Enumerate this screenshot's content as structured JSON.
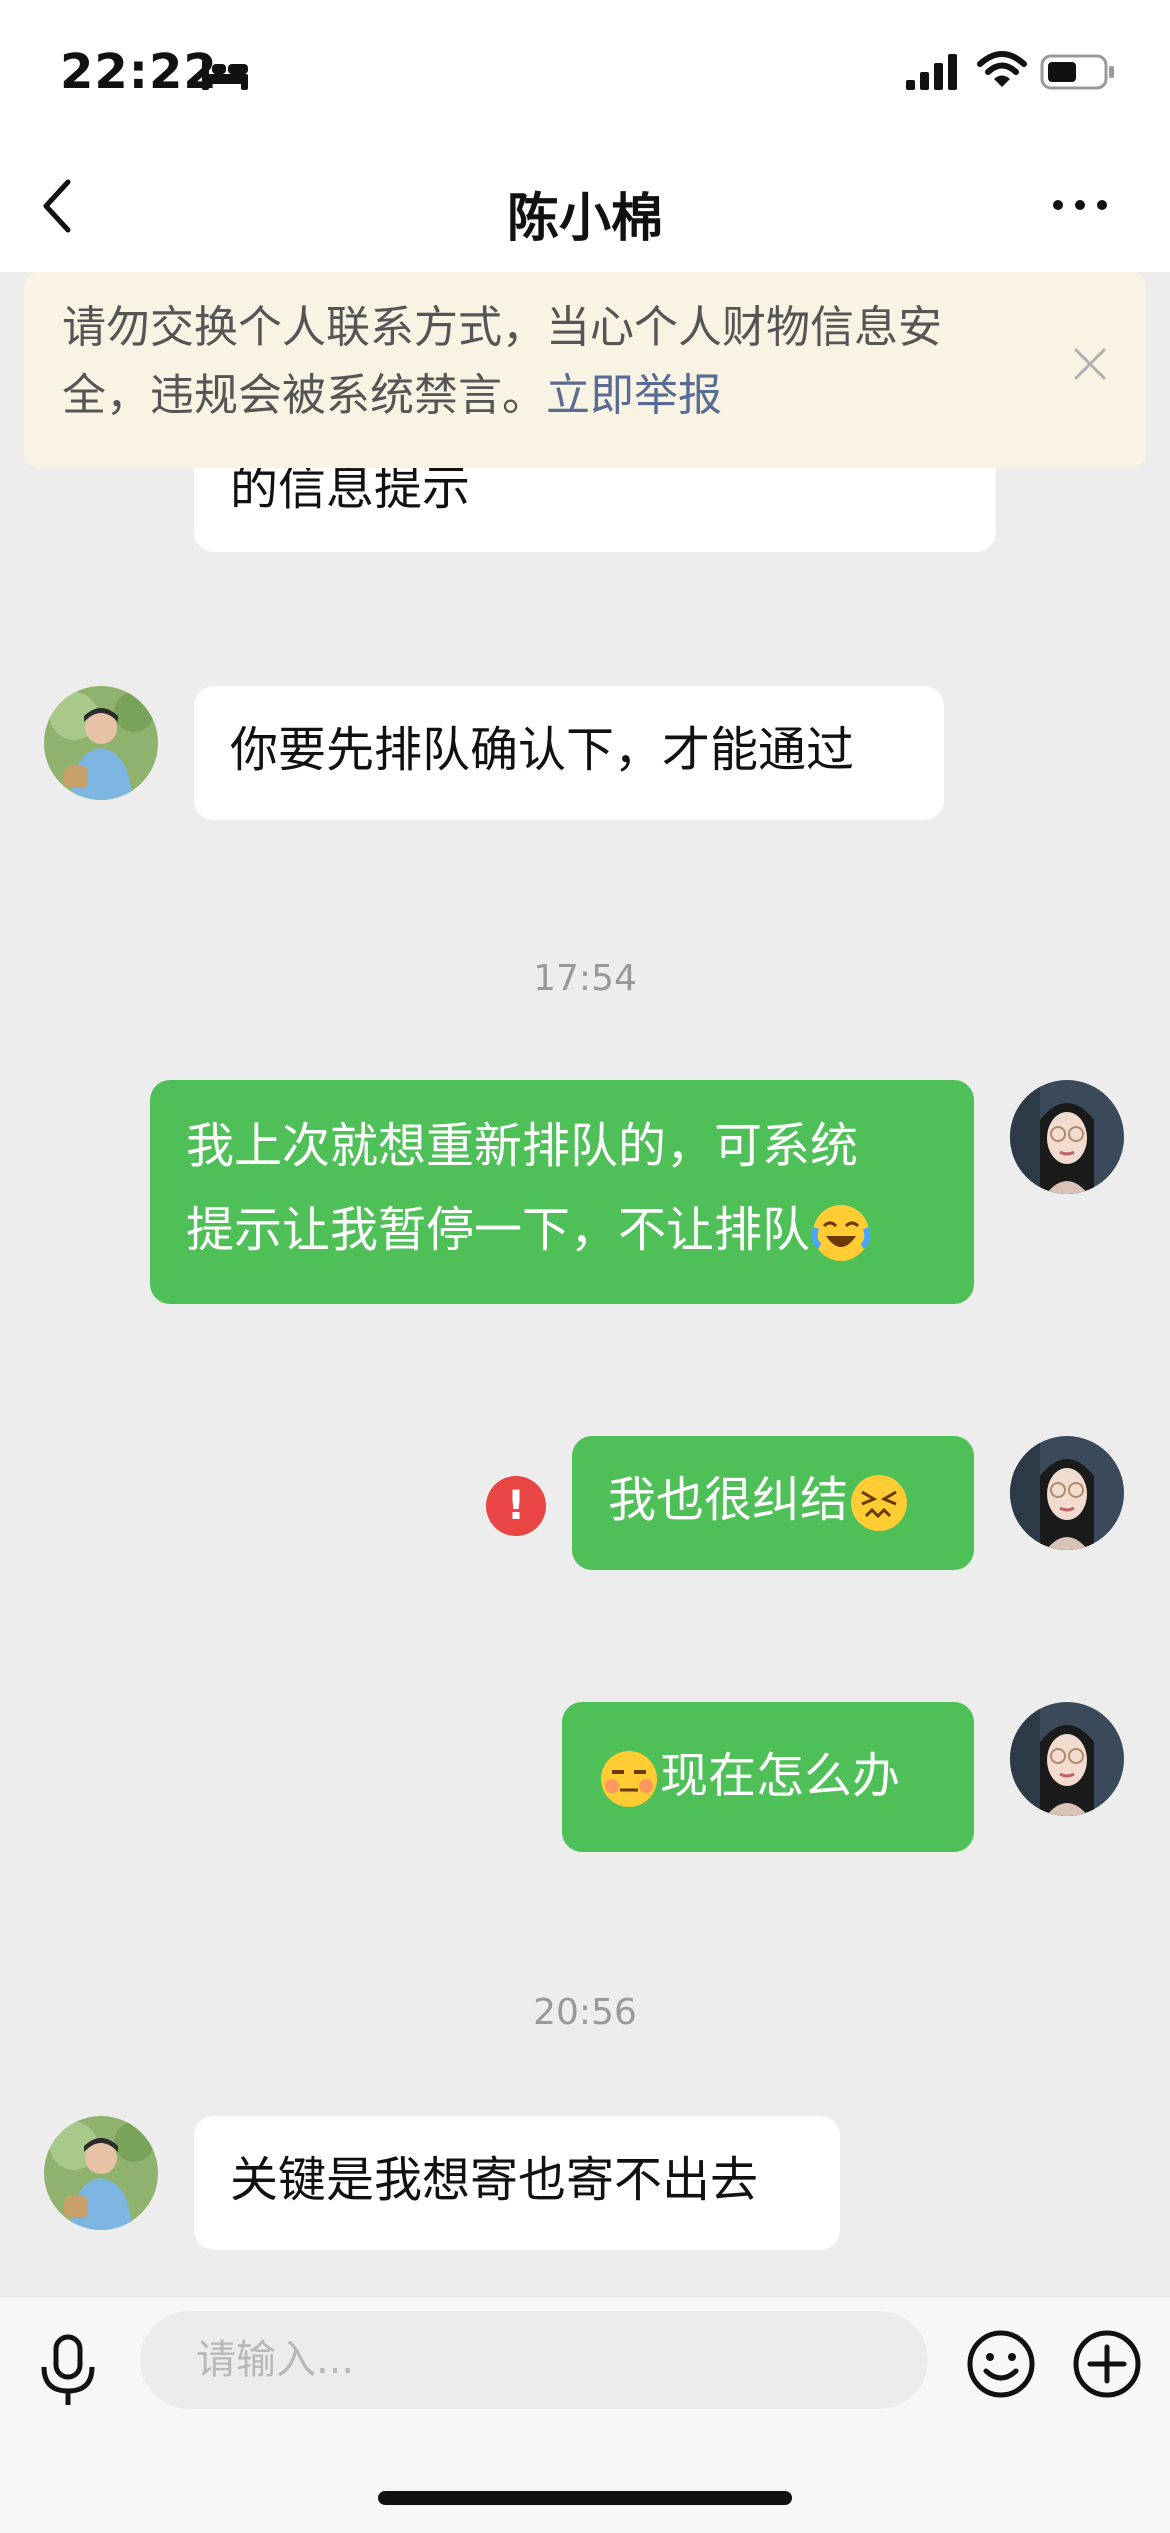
{
  "status_bar": {
    "time": "22:22",
    "icons": [
      "bed-icon",
      "signal-icon",
      "wifi-icon",
      "battery-icon"
    ]
  },
  "nav": {
    "title": "陈小棉",
    "icons": [
      "back-icon",
      "more-icon"
    ]
  },
  "warning": {
    "line1": "请勿交换个人联系方式，当心个人财物信息安",
    "line2": "全，违规会被系统禁言。",
    "link": "立即举报",
    "icon": "close-icon"
  },
  "messages": {
    "m0": {
      "sender": "contact",
      "text": "的信息提示"
    },
    "m1": {
      "sender": "contact",
      "text": "你要先排队确认下，才能通过"
    },
    "ts1": "17:54",
    "m2": {
      "sender": "me",
      "line1": "我上次就想重新排队的，可系统",
      "line2": "提示让我暂停一下，不让排队",
      "emoji": "crying-laughing-emoji"
    },
    "m3": {
      "sender": "me",
      "text": "我也很纠结",
      "emoji": "confounded-emoji",
      "status": "send-failed",
      "status_glyph": "!"
    },
    "m4": {
      "sender": "me",
      "text": "现在怎么办",
      "emoji": "unamused-emoji"
    },
    "ts2": "20:56",
    "m5": {
      "sender": "contact",
      "text": "关键是我想寄也寄不出去"
    }
  },
  "input_bar": {
    "placeholder": "请输入...",
    "icons": [
      "microphone-icon",
      "emoji-icon",
      "plus-icon"
    ]
  },
  "colors": {
    "outgoing_bubble": "#4fc058",
    "incoming_bubble": "#ffffff",
    "chat_background": "#ededed",
    "warning_background": "#f8f3e2",
    "link": "#576b95",
    "error": "#e94545"
  }
}
